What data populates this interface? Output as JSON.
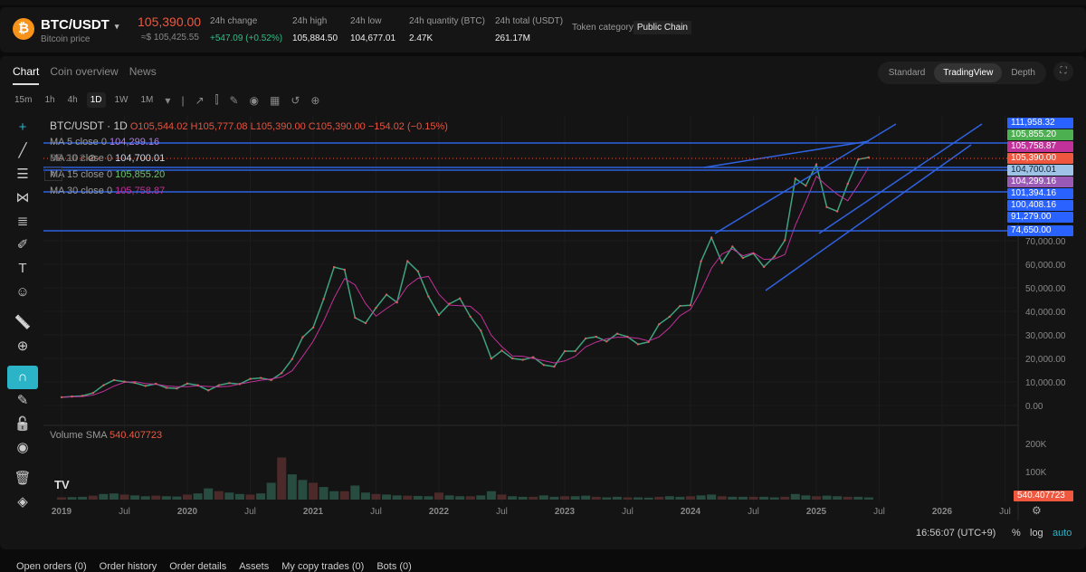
{
  "header": {
    "pair": "BTC/USDT",
    "caret": "▾",
    "subtitle": "Bitcoin price",
    "coin_icon": "₿",
    "last_price": "105,390.00",
    "usd_price": "≈$ 105,425.55",
    "stats": [
      {
        "label": "24h change",
        "value": "+547.09 (+0.52%)",
        "color": "#2ebd85"
      },
      {
        "label": "24h high",
        "value": "105,884.50"
      },
      {
        "label": "24h low",
        "value": "104,677.01"
      },
      {
        "label": "24h quantity (BTC)",
        "value": "2.47K"
      },
      {
        "label": "24h total (USDT)",
        "value": "261.17M"
      },
      {
        "label": "Token category",
        "value": "Public Chain"
      }
    ]
  },
  "tabs": [
    "Chart",
    "Coin overview",
    "News"
  ],
  "views": [
    "Standard",
    "TradingView",
    "Depth"
  ],
  "timeframes": [
    "15m",
    "1h",
    "4h",
    "1D",
    "1W",
    "1M"
  ],
  "chart": {
    "title": "BTC/USDT · 1D",
    "ohlc": "O105,544.02 H105,777.08 L105,390.00 C105,390.00 −154.02 (−0.15%)",
    "ma": [
      {
        "label": "MA 5 close 0",
        "value": "104,299.16",
        "color": "#b07fe0"
      },
      {
        "label": "MA 10 close 0",
        "value": "104,700.01",
        "color": "#cfd8e8"
      },
      {
        "label": "MA 15 close 0",
        "value": "105,855.20",
        "color": "#6dc36d"
      },
      {
        "label": "MA 30 close 0",
        "value": "105,758.87",
        "color": "#c2309a"
      }
    ],
    "bb": "BB 20 2",
    "volume_label": "Volume SMA",
    "volume_value": "540.407723",
    "price_tags": [
      {
        "v": "111,958.32",
        "c": "#2962ff"
      },
      {
        "v": "105,855.20",
        "c": "#4caf50"
      },
      {
        "v": "105,758.87",
        "c": "#c2309a"
      },
      {
        "v": "105,390.00",
        "c": "#f0573f"
      },
      {
        "v": "104,700.01",
        "c": "#9fc3e6",
        "dark": true
      },
      {
        "v": "104,299.16",
        "c": "#9b59b6"
      },
      {
        "v": "101,394.16",
        "c": "#2962ff"
      },
      {
        "v": "100,408.16",
        "c": "#2962ff"
      },
      {
        "v": "91,279.00",
        "c": "#2962ff"
      },
      {
        "v": "74,650.00",
        "c": "#2962ff"
      }
    ],
    "time": "16:56:07 (UTC+9)",
    "pct": "%",
    "log": "log",
    "auto": "auto"
  },
  "chart_data": {
    "type": "line",
    "x_start": "2019-01",
    "x_unit": "month",
    "xticks": [
      "2019",
      "Jul",
      "2020",
      "Jul",
      "2021",
      "Jul",
      "2022",
      "Jul",
      "2023",
      "Jul",
      "2024",
      "Jul",
      "2025",
      "Jul",
      "2026",
      "Jul"
    ],
    "yticks": [
      "70,000.00",
      "60,000.00",
      "50,000.00",
      "40,000.00",
      "30,000.00",
      "20,000.00",
      "10,000.00",
      "0.00"
    ],
    "vticks": [
      "200K",
      "100K"
    ],
    "price": [
      3500,
      3800,
      4100,
      5300,
      8600,
      10800,
      10100,
      9600,
      8300,
      9200,
      7500,
      7200,
      9300,
      8600,
      6400,
      8600,
      9500,
      9100,
      11300,
      11700,
      10800,
      13800,
      19700,
      29000,
      33100,
      45200,
      58800,
      57700,
      37300,
      35000,
      41500,
      47100,
      43800,
      61300,
      57000,
      46300,
      38500,
      43200,
      45500,
      37700,
      31800,
      19900,
      23300,
      20000,
      19400,
      20500,
      17200,
      16500,
      23100,
      23100,
      28500,
      29200,
      27200,
      30500,
      29200,
      26000,
      27000,
      34500,
      37700,
      42300,
      42600,
      61200,
      71300,
      60600,
      67500,
      62700,
      64600,
      58900,
      63300,
      70200,
      96400,
      93400,
      102400,
      84300,
      82500,
      94200,
      104600,
      105390
    ],
    "volume_k": [
      8,
      9,
      10,
      14,
      20,
      22,
      18,
      15,
      12,
      14,
      12,
      11,
      18,
      22,
      40,
      30,
      25,
      20,
      18,
      22,
      60,
      150,
      90,
      70,
      60,
      45,
      30,
      30,
      50,
      25,
      20,
      18,
      15,
      14,
      13,
      12,
      25,
      15,
      12,
      12,
      15,
      30,
      18,
      12,
      10,
      10,
      15,
      10,
      12,
      12,
      14,
      10,
      8,
      10,
      8,
      8,
      7,
      10,
      12,
      10,
      12,
      15,
      18,
      12,
      10,
      10,
      10,
      10,
      8,
      10,
      20,
      15,
      12,
      14,
      12,
      10,
      10,
      8
    ]
  },
  "bottom_tabs": [
    "Open orders (0)",
    "Order history",
    "Order details",
    "Assets",
    "My copy trades (0)",
    "Bots (0)"
  ]
}
